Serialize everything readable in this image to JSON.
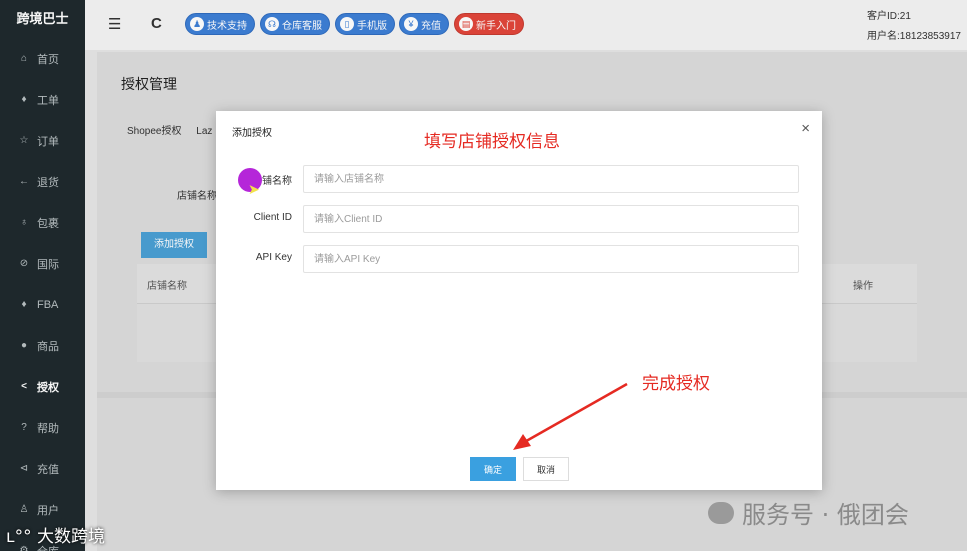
{
  "app": {
    "brand": "跨境巴士"
  },
  "sidebar": {
    "items": [
      {
        "label": "首页",
        "icon": "⌂"
      },
      {
        "label": "工单",
        "icon": "♦"
      },
      {
        "label": "订单",
        "icon": "☆"
      },
      {
        "label": "退货",
        "icon": "←"
      },
      {
        "label": "包裹",
        "icon": "♁"
      },
      {
        "label": "国际",
        "icon": "⊘"
      },
      {
        "label": "FBA",
        "icon": "♦"
      },
      {
        "label": "商品",
        "icon": "●"
      },
      {
        "label": "授权",
        "icon": "<"
      },
      {
        "label": "帮助",
        "icon": "?"
      },
      {
        "label": "充值",
        "icon": "⊲"
      },
      {
        "label": "用户",
        "icon": "♙"
      },
      {
        "label": "仓库",
        "icon": "⚙"
      }
    ]
  },
  "topbar": {
    "menu_icon": "☰",
    "refresh_icon": "C",
    "buttons": [
      {
        "label": "技术支持",
        "icon": "♟"
      },
      {
        "label": "仓库客服",
        "icon": "☊"
      },
      {
        "label": "手机版",
        "icon": "▯"
      },
      {
        "label": "充值",
        "icon": "¥"
      },
      {
        "label": "新手入门",
        "icon": "▤"
      }
    ],
    "customer_id": "客户ID:21",
    "username": "用户名:18123853917"
  },
  "page": {
    "title": "授权管理",
    "tabs": [
      "Shopee授权",
      "Laz"
    ],
    "store_label": "店铺名称",
    "add_button": "添加授权",
    "table_headers": {
      "store": "店铺名称",
      "action": "操作"
    }
  },
  "modal": {
    "title": "添加授权",
    "close_icon": "×",
    "fields": [
      {
        "label": "店铺名称",
        "placeholder": "请输入店铺名称"
      },
      {
        "label": "Client ID",
        "placeholder": "请输入Client ID"
      },
      {
        "label": "API Key",
        "placeholder": "请输入API Key"
      }
    ],
    "confirm": "确定",
    "cancel": "取消"
  },
  "annotations": {
    "fill_info": "填写店铺授权信息",
    "complete": "完成授权"
  },
  "watermarks": {
    "left": "大数跨境",
    "right": "服务号 · 俄团会"
  }
}
